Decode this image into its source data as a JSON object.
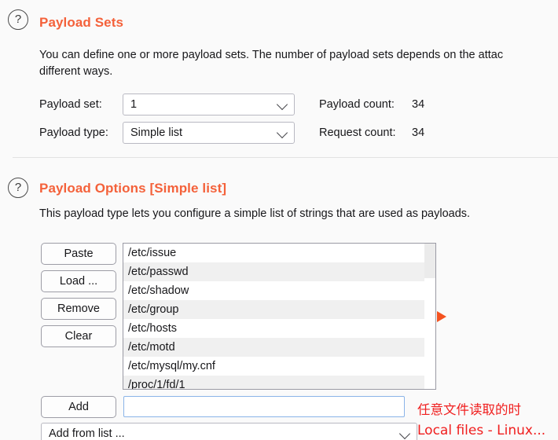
{
  "payload_sets": {
    "help_icon": "question-mark-circle-icon",
    "title": "Payload Sets",
    "description_line1": "You can define one or more payload sets. The number of payload sets depends on the attac",
    "description_line2": "different ways.",
    "payload_set_label": "Payload set:",
    "payload_set_value": "1",
    "payload_type_label": "Payload type:",
    "payload_type_value": "Simple list",
    "payload_count_label": "Payload count:",
    "payload_count_value": "34",
    "request_count_label": "Request count:",
    "request_count_value": "34",
    "chevron_icon": "chevron-down-icon"
  },
  "payload_options": {
    "help_icon": "question-mark-circle-icon",
    "title": "Payload Options [Simple list]",
    "description": "This payload type lets you configure a simple list of strings that are used as payloads.",
    "buttons": [
      {
        "label": "Paste",
        "name": "paste-button"
      },
      {
        "label": "Load ...",
        "name": "load-button"
      },
      {
        "label": "Remove",
        "name": "remove-button"
      },
      {
        "label": "Clear",
        "name": "clear-button"
      }
    ],
    "payload_list": [
      "/etc/issue",
      "/etc/passwd",
      "/etc/shadow",
      "/etc/group",
      "/etc/hosts",
      "/etc/motd",
      "/etc/mysql/my.cnf",
      "/proc/1/fd/1"
    ],
    "add_button_label": "Add",
    "add_input_value": "",
    "add_input_placeholder": "",
    "add_from_list_label": "Add from list ...",
    "chevron_icon": "chevron-down-icon",
    "marker_icon": "right-triangle-marker-icon"
  },
  "annotations": {
    "chinese_note": "任意文件读取的时",
    "english_note": "Local files - Linux..."
  },
  "colors": {
    "accent_orange": "#f4613a",
    "annotation_red": "#f01e1e",
    "marker_orange": "#f4521f",
    "input_focus_blue": "#8ab4e8",
    "page_background": "#fafafa"
  }
}
